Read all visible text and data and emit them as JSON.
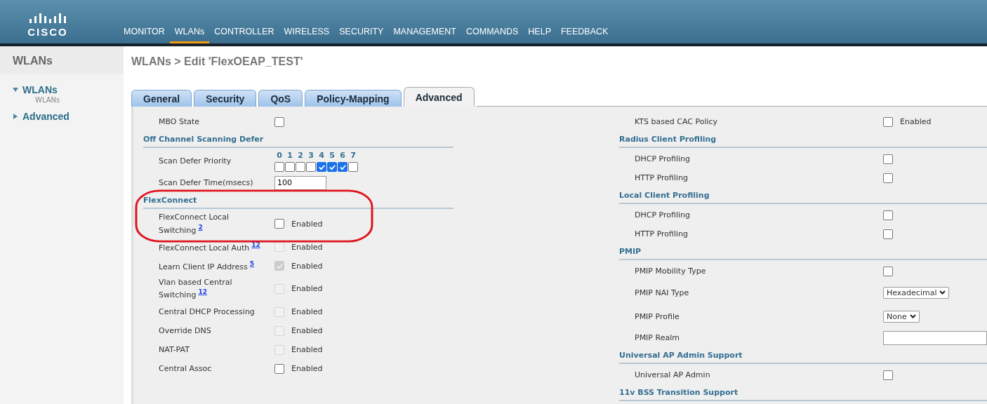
{
  "header": {
    "logo_text": "CISCO",
    "nav": [
      {
        "label": "MONITOR",
        "selected": false
      },
      {
        "label": "WLANs",
        "selected": true
      },
      {
        "label": "CONTROLLER",
        "selected": false
      },
      {
        "label": "WIRELESS",
        "selected": false
      },
      {
        "label": "SECURITY",
        "selected": false
      },
      {
        "label": "MANAGEMENT",
        "selected": false
      },
      {
        "label": "COMMANDS",
        "selected": false
      },
      {
        "label": "HELP",
        "selected": false
      },
      {
        "label": "FEEDBACK",
        "selected": false
      }
    ]
  },
  "sidebar": {
    "title": "WLANs",
    "items": [
      {
        "label": "WLANs",
        "expanded": true,
        "children": [
          {
            "label": "WLANs"
          }
        ]
      },
      {
        "label": "Advanced",
        "expanded": false
      }
    ]
  },
  "page_title": "WLANs > Edit  'FlexOEAP_TEST'",
  "tabs": [
    {
      "label": "General",
      "selected": false
    },
    {
      "label": "Security",
      "selected": false
    },
    {
      "label": "QoS",
      "selected": false
    },
    {
      "label": "Policy-Mapping",
      "selected": false
    },
    {
      "label": "Advanced",
      "selected": true
    }
  ],
  "left": {
    "sections": [
      {
        "rows": [
          {
            "kind": "checkbox",
            "label": "MBO State",
            "checked": false,
            "disabled": false
          }
        ]
      },
      {
        "title": "Off Channel Scanning Defer",
        "rows": [
          {
            "kind": "priority",
            "label": "Scan Defer Priority",
            "priorities": [
              {
                "label": "0",
                "checked": false
              },
              {
                "label": "1",
                "checked": false
              },
              {
                "label": "2",
                "checked": false
              },
              {
                "label": "3",
                "checked": false
              },
              {
                "label": "4",
                "checked": true
              },
              {
                "label": "5",
                "checked": true
              },
              {
                "label": "6",
                "checked": true
              },
              {
                "label": "7",
                "checked": false
              }
            ]
          },
          {
            "kind": "input",
            "label": "Scan Defer Time(msecs)",
            "value": "100"
          }
        ]
      },
      {
        "title": "FlexConnect",
        "highlighted": true,
        "rows": [
          {
            "kind": "checkbox",
            "label": "FlexConnect Local Switching",
            "note": "2",
            "checked": false,
            "disabled": false,
            "text": "Enabled"
          },
          {
            "kind": "checkbox",
            "label": "FlexConnect Local Auth",
            "note": "12",
            "checked": false,
            "disabled": true,
            "text": "Enabled"
          },
          {
            "kind": "checkbox",
            "label": "Learn Client IP Address",
            "note": "5",
            "checked": true,
            "disabled": true,
            "text": "Enabled"
          },
          {
            "kind": "checkbox",
            "label": "Vlan based Central Switching",
            "note": "12",
            "checked": false,
            "disabled": true,
            "text": "Enabled"
          },
          {
            "kind": "checkbox",
            "label": "Central DHCP Processing",
            "checked": false,
            "disabled": true,
            "text": "Enabled"
          },
          {
            "kind": "checkbox",
            "label": "Override DNS",
            "checked": false,
            "disabled": true,
            "text": "Enabled"
          },
          {
            "kind": "checkbox",
            "label": "NAT-PAT",
            "checked": false,
            "disabled": true,
            "text": "Enabled"
          },
          {
            "kind": "checkbox",
            "label": "Central Assoc",
            "checked": false,
            "disabled": false,
            "text": "Enabled"
          }
        ]
      }
    ]
  },
  "right": {
    "sections": [
      {
        "rows": [
          {
            "kind": "checkbox",
            "label": "KTS based CAC Policy",
            "checked": false,
            "disabled": false,
            "text": "Enabled"
          }
        ]
      },
      {
        "title": "Radius Client Profiling",
        "rows": [
          {
            "kind": "checkbox",
            "label": "DHCP Profiling",
            "checked": false,
            "disabled": false
          },
          {
            "kind": "checkbox",
            "label": "HTTP Profiling",
            "checked": false,
            "disabled": false
          }
        ]
      },
      {
        "title": "Local Client Profiling",
        "rows": [
          {
            "kind": "checkbox",
            "label": "DHCP Profiling",
            "checked": false,
            "disabled": false
          },
          {
            "kind": "checkbox",
            "label": "HTTP Profiling",
            "checked": false,
            "disabled": false
          }
        ]
      },
      {
        "title": "PMIP",
        "rows": [
          {
            "kind": "checkbox",
            "label": "PMIP Mobility Type",
            "checked": false,
            "disabled": false
          },
          {
            "kind": "select",
            "label": "PMIP NAI Type",
            "value": "Hexadecimal"
          },
          {
            "kind": "select",
            "label": "PMIP Profile",
            "value": "None"
          },
          {
            "kind": "input",
            "label": "PMIP Realm"
          }
        ]
      },
      {
        "title": "Universal AP Admin Support",
        "rows": [
          {
            "kind": "checkbox",
            "label": "Universal AP Admin",
            "checked": false,
            "disabled": false
          }
        ]
      },
      {
        "title": "11v BSS Transition Support"
      }
    ]
  }
}
